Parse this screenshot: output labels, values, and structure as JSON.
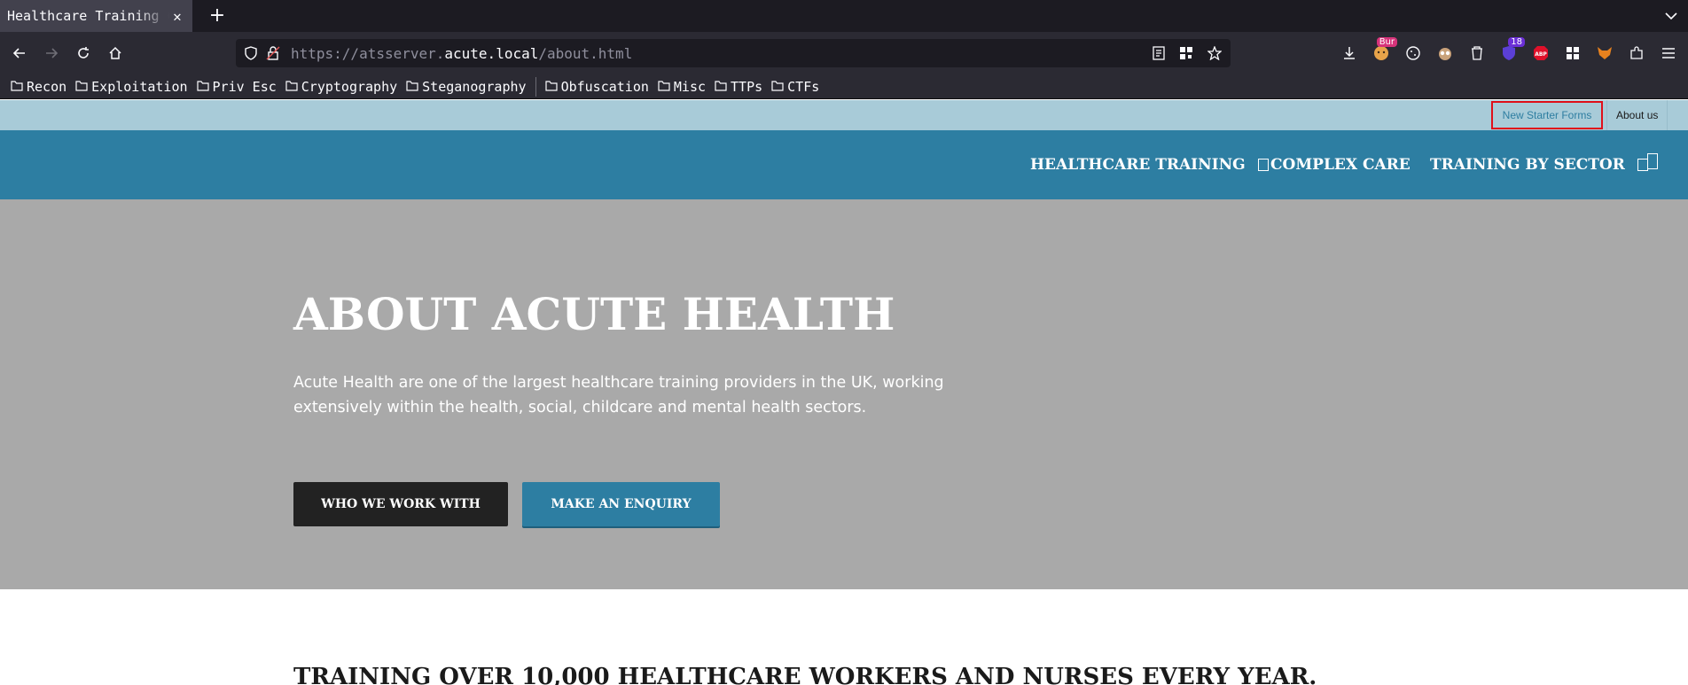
{
  "browser": {
    "tab": {
      "title": "Healthcare Training C"
    },
    "url": {
      "scheme": "https://",
      "subdomain": "atsserver.",
      "domain": "acute.local",
      "path": "/about.html"
    },
    "extensions": [
      {
        "icon": "cookie-face-icon",
        "badge": "Bur"
      },
      {
        "icon": "cookie-icon"
      },
      {
        "icon": "owl-icon"
      },
      {
        "icon": "trash-icon"
      },
      {
        "icon": "ublock-icon",
        "badge": "18"
      },
      {
        "icon": "adblock-icon",
        "label": "ABP"
      },
      {
        "icon": "grid-icon"
      },
      {
        "icon": "fox-icon"
      },
      {
        "icon": "puzzle-icon"
      },
      {
        "icon": "menu-icon"
      }
    ],
    "bookmarks": [
      "Recon",
      "Exploitation",
      "Priv Esc",
      "Cryptography",
      "Steganography",
      "Obfuscation",
      "Misc",
      "TTPs",
      "CTFs"
    ]
  },
  "site": {
    "topbar": {
      "new_starter": "New Starter Forms",
      "about": "About us"
    },
    "nav": {
      "healthcare_training": "HEALTHCARE TRAINING",
      "complex_care": "COMPLEX CARE",
      "training_by_sector": "TRAINING BY SECTOR"
    },
    "hero": {
      "title": "ABOUT ACUTE HEALTH",
      "text": "Acute Health are one of the largest healthcare training providers in the UK, working extensively within the health, social, childcare and mental health sectors.",
      "btn_primary": "WHO WE WORK WITH",
      "btn_secondary": "MAKE AN ENQUIRY"
    },
    "section_title": "TRAINING OVER 10,000 HEALTHCARE WORKERS AND NURSES EVERY YEAR."
  },
  "colors": {
    "nav_bg": "#2d7ea2",
    "topbar_bg": "#a8cbd8",
    "hero_bg": "#a9a9a9",
    "highlight": "#e0101a"
  }
}
